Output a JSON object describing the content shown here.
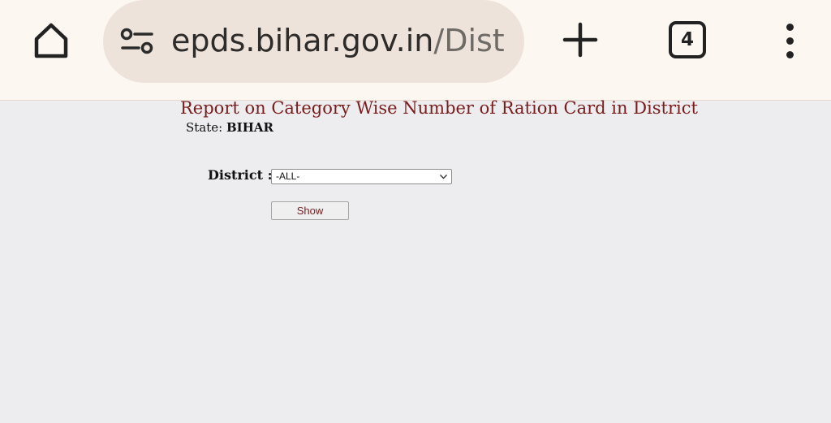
{
  "browser": {
    "url_domain": "epds.bihar.gov.in",
    "url_path": "/Distr",
    "tab_count": "4"
  },
  "report": {
    "title": "Report on Category Wise Number of Ration Card in District",
    "state_label": "State:",
    "state_value": "BIHAR"
  },
  "form": {
    "district_label": "District :",
    "district_selected": "-ALL-",
    "show_label": "Show"
  },
  "colors": {
    "title": "#7a1c1c",
    "page_bg": "#edecee",
    "toolbar_bg": "#fdf7f2",
    "url_pill_bg": "#eee3da"
  }
}
